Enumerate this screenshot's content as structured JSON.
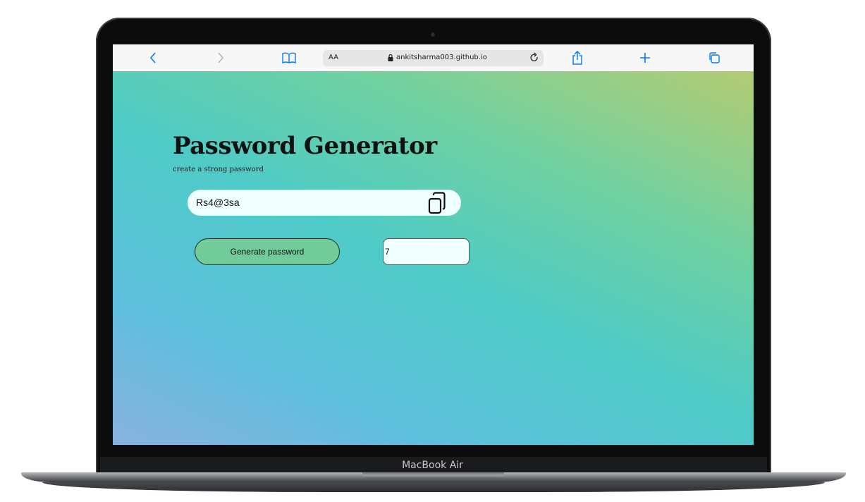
{
  "device": {
    "brand": "MacBook Air"
  },
  "browser": {
    "reader_label": "AA",
    "url": "ankitsharma003.github.io",
    "toolbar_icons": [
      "back-icon",
      "forward-icon",
      "bookmarks-icon",
      "lock-icon",
      "reload-icon",
      "share-icon",
      "new-tab-icon",
      "tabs-icon"
    ]
  },
  "page": {
    "title": "Password Generator",
    "subtitle": "create a strong password",
    "password_value": "Rs4@3sa",
    "generate_label": "Generate password",
    "length_value": "7"
  },
  "colors": {
    "accent": "#007aff",
    "button_bg": "#71cc9a",
    "field_bg": "#f0ffff"
  }
}
